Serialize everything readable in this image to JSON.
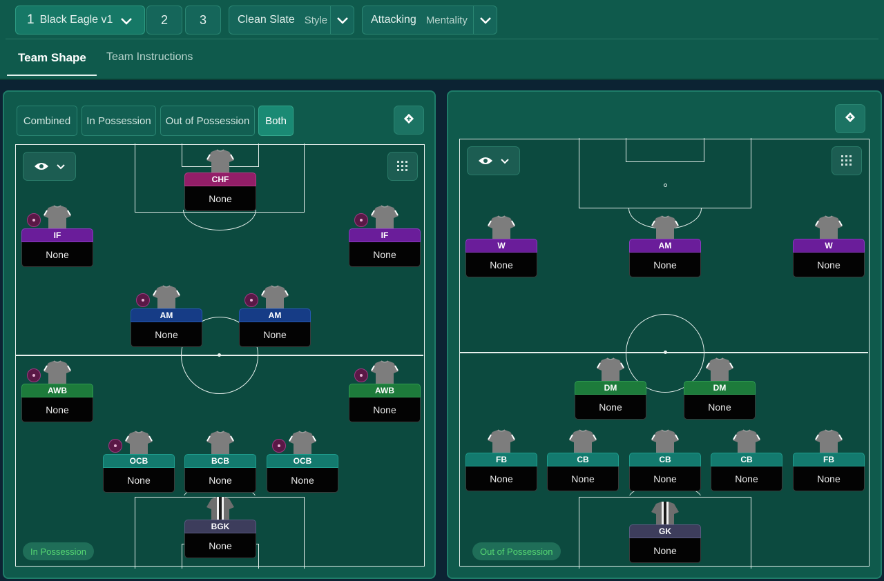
{
  "header": {
    "tactic_number": "1",
    "tactic_name": "Black Eagle v1",
    "slot2": "2",
    "slot3": "3",
    "style_value": "Clean Slate",
    "style_label": "Style",
    "mentality_value": "Attacking",
    "mentality_label": "Mentality"
  },
  "tabs": {
    "team_shape": "Team Shape",
    "team_instructions": "Team Instructions"
  },
  "left_panel": {
    "segments": [
      "Combined",
      "In Possession",
      "Out of Possession",
      "Both"
    ],
    "selected_segment": "Both",
    "phase_label": "In Possession",
    "players": [
      {
        "role": "CHF",
        "name": "None",
        "color": "crimson"
      },
      {
        "role": "IF",
        "name": "None",
        "color": "purple"
      },
      {
        "role": "IF",
        "name": "None",
        "color": "purple"
      },
      {
        "role": "AM",
        "name": "None",
        "color": "blue"
      },
      {
        "role": "AM",
        "name": "None",
        "color": "blue"
      },
      {
        "role": "AWB",
        "name": "None",
        "color": "green"
      },
      {
        "role": "AWB",
        "name": "None",
        "color": "green"
      },
      {
        "role": "OCB",
        "name": "None",
        "color": "teal"
      },
      {
        "role": "BCB",
        "name": "None",
        "color": "teal"
      },
      {
        "role": "OCB",
        "name": "None",
        "color": "teal"
      },
      {
        "role": "BGK",
        "name": "None",
        "color": "slate"
      }
    ]
  },
  "right_panel": {
    "phase_label": "Out of Possession",
    "players": [
      {
        "role": "W",
        "name": "None",
        "color": "purple"
      },
      {
        "role": "AM",
        "name": "None",
        "color": "purple"
      },
      {
        "role": "W",
        "name": "None",
        "color": "purple"
      },
      {
        "role": "DM",
        "name": "None",
        "color": "green"
      },
      {
        "role": "DM",
        "name": "None",
        "color": "green"
      },
      {
        "role": "FB",
        "name": "None",
        "color": "teal"
      },
      {
        "role": "CB",
        "name": "None",
        "color": "teal"
      },
      {
        "role": "CB",
        "name": "None",
        "color": "teal"
      },
      {
        "role": "CB",
        "name": "None",
        "color": "teal"
      },
      {
        "role": "FB",
        "name": "None",
        "color": "teal"
      },
      {
        "role": "GK",
        "name": "None",
        "color": "slate"
      }
    ]
  },
  "colors": {
    "panel_bg": "#0f5a4c",
    "pitch_bg": "#0c4a3f",
    "role_purple": "#6a1d9a",
    "role_blue": "#163c86",
    "role_green": "#1d7b3b",
    "role_teal": "#137a6e",
    "role_crimson": "#931e68",
    "role_slate": "#3d3d5c",
    "phase_text": "#56d873"
  },
  "icons": [
    "chevron-down-icon",
    "tactics-board-icon",
    "eye-icon",
    "grid-icon",
    "player-shirt-icon",
    "instruction-indicator-icon"
  ]
}
